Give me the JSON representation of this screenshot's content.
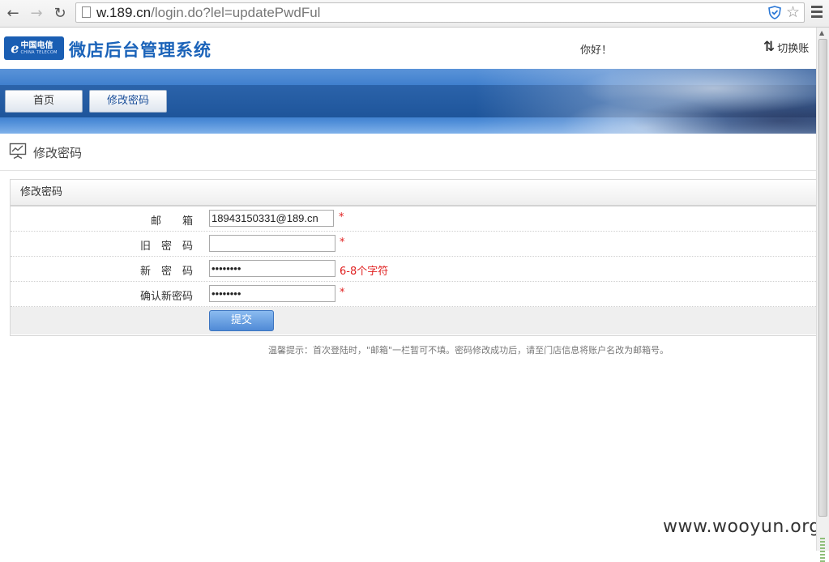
{
  "browser": {
    "url_host": "w.189.cn",
    "url_path": "/login.do?lel=updatePwdFul"
  },
  "header": {
    "logo_cn": "中国电信",
    "logo_en": "CHINA TELECOM",
    "system_title": "微店后台管理系统",
    "greeting": "你好！",
    "switch_account": "切换账"
  },
  "nav": {
    "tabs": [
      {
        "label": "首页"
      },
      {
        "label": "修改密码"
      }
    ]
  },
  "page": {
    "title": "修改密码",
    "panel_title": "修改密码"
  },
  "form": {
    "email": {
      "label": "邮　　箱",
      "value": "18943150331@189.cn",
      "required": "*"
    },
    "old_password": {
      "label": "旧　密　码",
      "value": "",
      "required": "*"
    },
    "new_password": {
      "label": "新　密　码",
      "value": "••••••••",
      "hint": "6-8个字符"
    },
    "confirm_password": {
      "label": "确认新密码",
      "value": "••••••••",
      "required": "*"
    },
    "submit_label": "提交"
  },
  "tip": "温馨提示：首次登陆时，\"邮箱\"一栏暂可不填。密码修改成功后，请至门店信息将账户名改为邮箱号。",
  "watermark": "www.wooyun.org",
  "colors": {
    "brand_blue": "#1b63b9",
    "required_red": "#e02020"
  }
}
